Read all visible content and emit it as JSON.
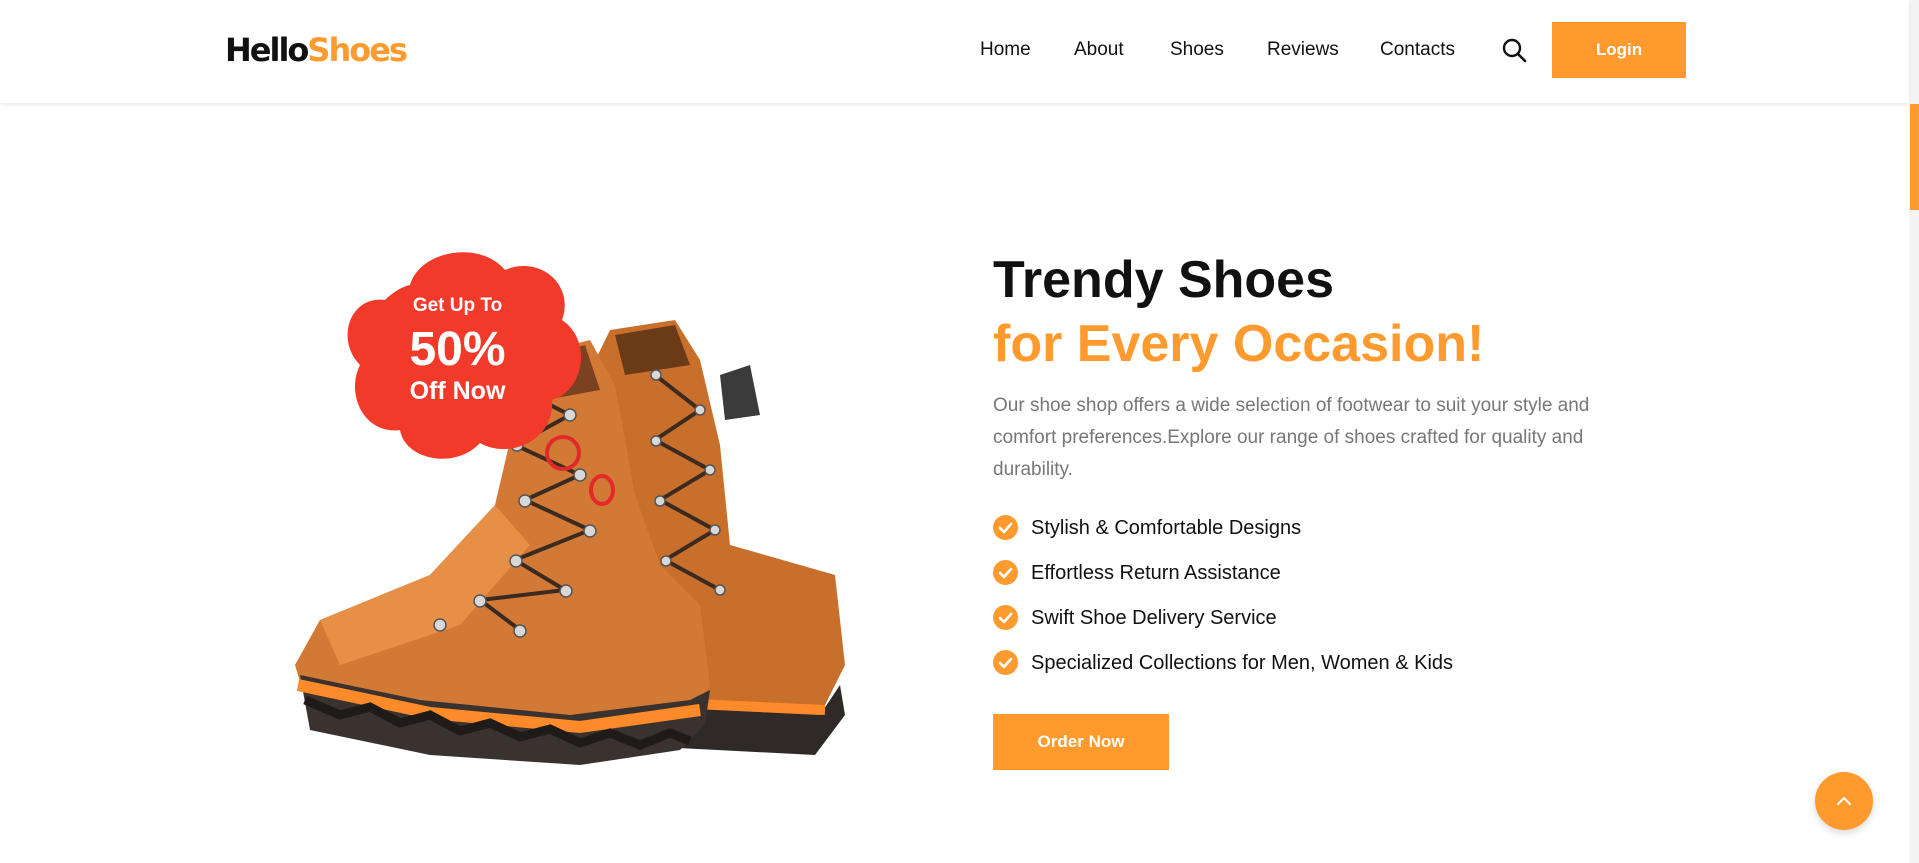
{
  "header": {
    "logo": {
      "part1": "Hello",
      "part2": "Shoes"
    },
    "nav": [
      {
        "label": "Home"
      },
      {
        "label": "About"
      },
      {
        "label": "Shoes"
      },
      {
        "label": "Reviews"
      },
      {
        "label": "Contacts"
      }
    ],
    "search_icon": "search-icon",
    "login_label": "Login"
  },
  "hero": {
    "badge": {
      "line1": "Get Up To",
      "percent": "50%",
      "line3": "Off Now"
    },
    "title_line1": "Trendy Shoes",
    "title_line2": "for Every Occasion!",
    "description": "Our shoe shop offers a wide selection of footwear to suit your style and comfort preferences.Explore our range of shoes crafted for quality and durability.",
    "features": [
      {
        "label": "Stylish & Comfortable Designs"
      },
      {
        "label": "Effortless Return Assistance"
      },
      {
        "label": "Swift Shoe Delivery Service"
      },
      {
        "label": "Specialized Collections for Men, Women & Kids"
      }
    ],
    "order_label": "Order Now"
  },
  "icons": {
    "check": "check-circle-icon",
    "back_to_top": "chevron-up-icon"
  },
  "colors": {
    "accent": "#ff9a2e",
    "badge": "#f23a2a",
    "text": "#111111",
    "muted": "#777777"
  }
}
